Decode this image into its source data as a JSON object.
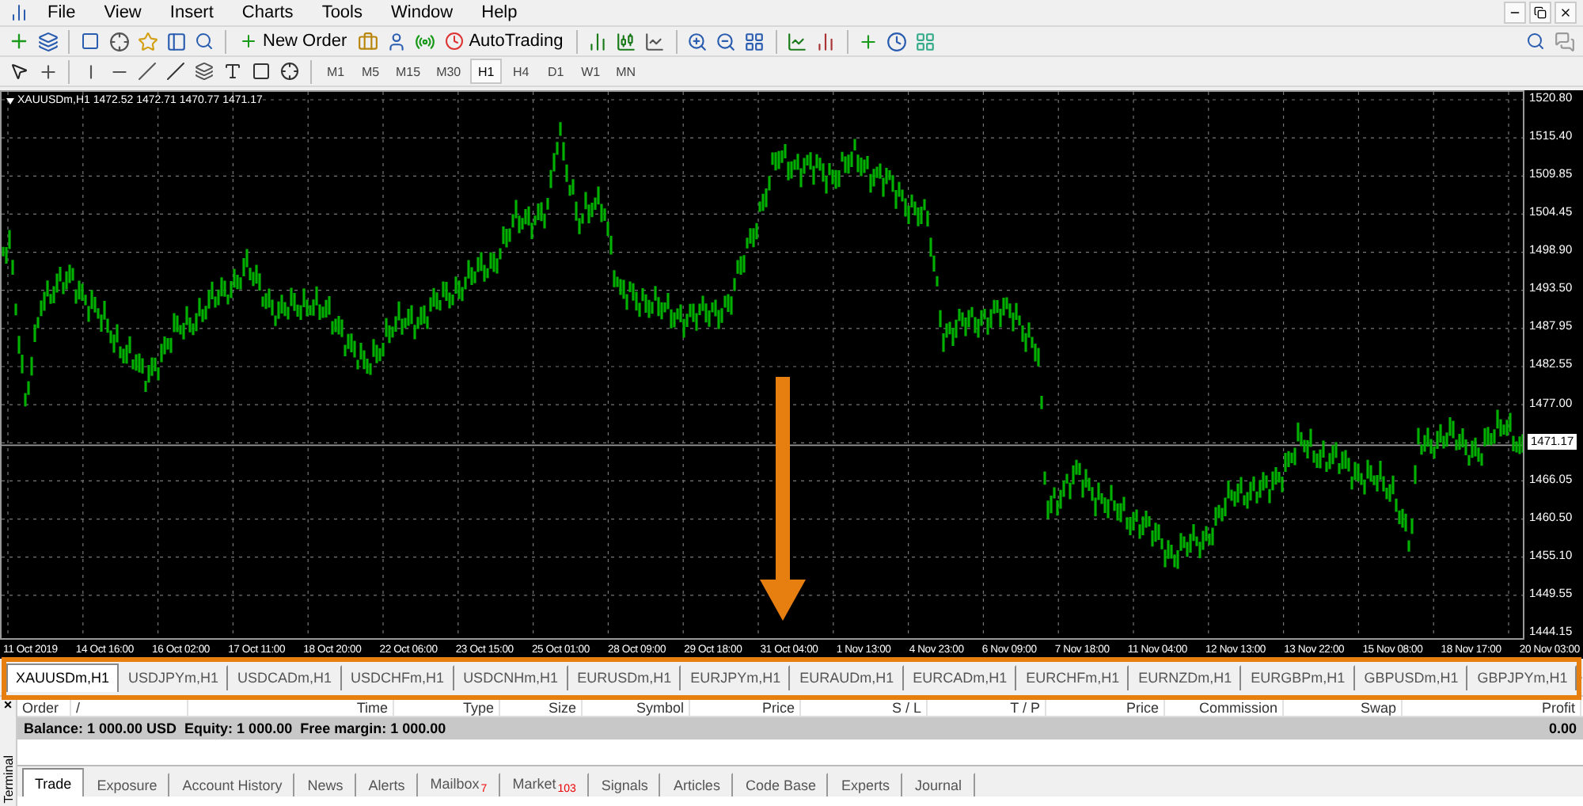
{
  "menu": [
    "File",
    "View",
    "Insert",
    "Charts",
    "Tools",
    "Window",
    "Help"
  ],
  "toolbar": {
    "new_order": "New Order",
    "auto_trading": "AutoTrading"
  },
  "timeframes": [
    {
      "label": "M1",
      "selected": false
    },
    {
      "label": "M5",
      "selected": false
    },
    {
      "label": "M15",
      "selected": false
    },
    {
      "label": "M30",
      "selected": false
    },
    {
      "label": "H1",
      "selected": true
    },
    {
      "label": "H4",
      "selected": false
    },
    {
      "label": "D1",
      "selected": false
    },
    {
      "label": "W1",
      "selected": false
    },
    {
      "label": "MN",
      "selected": false
    }
  ],
  "chart": {
    "symbol": "XAUUSDm,H1",
    "ohlc": "1472.52 1472.71 1470.77 1471.17",
    "current_price": "1471.17",
    "price_labels": [
      "1520.80",
      "1515.40",
      "1509.85",
      "1504.45",
      "1498.90",
      "1493.50",
      "1487.95",
      "1482.55",
      "1477.00",
      "1466.05",
      "1460.50",
      "1455.10",
      "1449.55",
      "1444.15"
    ],
    "time_labels": [
      "11 Oct 2019",
      "14 Oct 16:00",
      "16 Oct 02:00",
      "17 Oct 11:00",
      "18 Oct 20:00",
      "22 Oct 06:00",
      "23 Oct 15:00",
      "25 Oct 01:00",
      "28 Oct 09:00",
      "29 Oct 18:00",
      "31 Oct 04:00",
      "1 Nov 13:00",
      "4 Nov 23:00",
      "6 Nov 09:00",
      "7 Nov 18:00",
      "11 Nov 04:00",
      "12 Nov 13:00",
      "13 Nov 22:00",
      "15 Nov 08:00",
      "18 Nov 17:00",
      "20 Nov 03:00"
    ]
  },
  "symbol_tabs": [
    {
      "label": "XAUUSDm,H1",
      "selected": true
    },
    {
      "label": "USDJPYm,H1",
      "selected": false
    },
    {
      "label": "USDCADm,H1",
      "selected": false
    },
    {
      "label": "USDCHFm,H1",
      "selected": false
    },
    {
      "label": "USDCNHm,H1",
      "selected": false
    },
    {
      "label": "EURUSDm,H1",
      "selected": false
    },
    {
      "label": "EURJPYm,H1",
      "selected": false
    },
    {
      "label": "EURAUDm,H1",
      "selected": false
    },
    {
      "label": "EURCADm,H1",
      "selected": false
    },
    {
      "label": "EURCHFm,H1",
      "selected": false
    },
    {
      "label": "EURNZDm,H1",
      "selected": false
    },
    {
      "label": "EURGBPm,H1",
      "selected": false
    },
    {
      "label": "GBPUSDm,H1",
      "selected": false
    },
    {
      "label": "GBPJPYm,H1",
      "selected": false
    }
  ],
  "terminal": {
    "title": "Terminal",
    "close": "×",
    "columns": [
      "Order",
      "/",
      "Time",
      "Type",
      "Size",
      "Symbol",
      "Price",
      "S / L",
      "T / P",
      "Price",
      "Commission",
      "Swap",
      "Profit"
    ],
    "balance": "Balance: 1 000.00 USD  Equity: 1 000.00  Free margin: 1 000.00",
    "profit": "0.00",
    "tabs": [
      {
        "label": "Trade",
        "selected": true
      },
      {
        "label": "Exposure",
        "selected": false
      },
      {
        "label": "Account History",
        "selected": false
      },
      {
        "label": "News",
        "selected": false
      },
      {
        "label": "Alerts",
        "selected": false
      },
      {
        "label": "Mailbox",
        "badge": "7",
        "selected": false
      },
      {
        "label": "Market",
        "badge": "103",
        "selected": false
      },
      {
        "label": "Signals",
        "selected": false
      },
      {
        "label": "Articles",
        "selected": false
      },
      {
        "label": "Code Base",
        "selected": false
      },
      {
        "label": "Experts",
        "selected": false
      },
      {
        "label": "Journal",
        "selected": false
      }
    ]
  }
}
